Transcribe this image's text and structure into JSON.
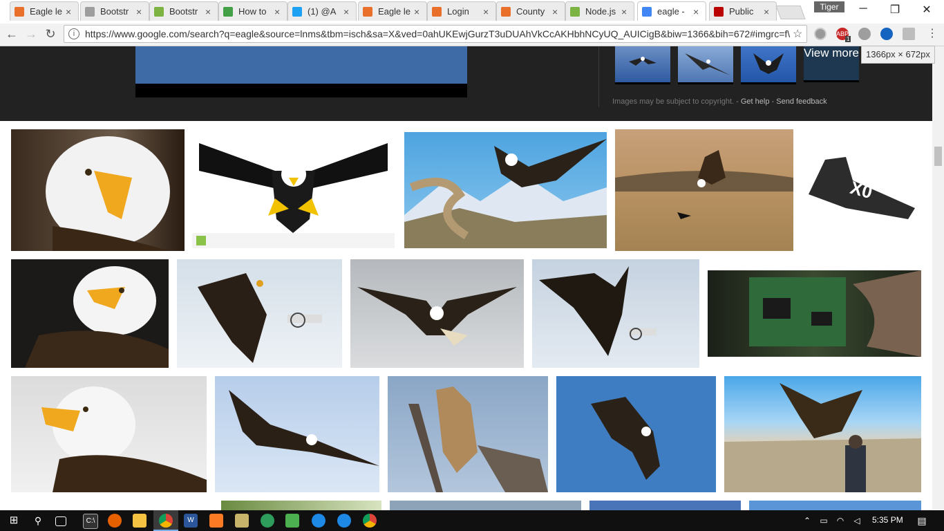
{
  "browser": {
    "tabs": [
      {
        "title": "Eagle le",
        "favicon": "xampp-icon",
        "color": "#e8702a",
        "active": false
      },
      {
        "title": "Bootstr",
        "favicon": "document-icon",
        "color": "#9e9e9e",
        "active": false
      },
      {
        "title": "Bootstr",
        "favicon": "node-icon",
        "color": "#7cb342",
        "active": false
      },
      {
        "title": "How to",
        "favicon": "node-icon",
        "color": "#43a047",
        "active": false
      },
      {
        "title": "(1) @A",
        "favicon": "twitter-icon",
        "color": "#1da1f2",
        "active": false
      },
      {
        "title": "Eagle le",
        "favicon": "xampp-icon",
        "color": "#e8702a",
        "active": false
      },
      {
        "title": "Login",
        "favicon": "xampp-icon",
        "color": "#e8702a",
        "active": false
      },
      {
        "title": "County",
        "favicon": "xampp-icon",
        "color": "#e8702a",
        "active": false
      },
      {
        "title": "Node.js",
        "favicon": "node-icon",
        "color": "#7cb342",
        "active": false
      },
      {
        "title": "eagle -",
        "favicon": "google-icon",
        "color": "#4285f4",
        "active": true
      },
      {
        "title": "Public",
        "favicon": "kenya-flag-icon",
        "color": "#bb0000",
        "active": false
      }
    ],
    "profile_name": "Tiger",
    "url": "https://www.google.com/search?q=eagle&source=lnms&tbm=isch&sa=X&ved=0ahUKEwjGurzT3uDUAhVkCcAKHbhNCyUQ_AUICigB&biw=1366&bih=672#imgrc=f\\",
    "extension_badge": "1",
    "viewport_tooltip": "1366px  ×  672px"
  },
  "preview_panel": {
    "view_more_label": "View more",
    "copyright_text": "Images may be subject to copyright.",
    "get_help": "Get help",
    "send_feedback": "Send feedback"
  },
  "taskbar": {
    "time": "5:35 PM"
  }
}
